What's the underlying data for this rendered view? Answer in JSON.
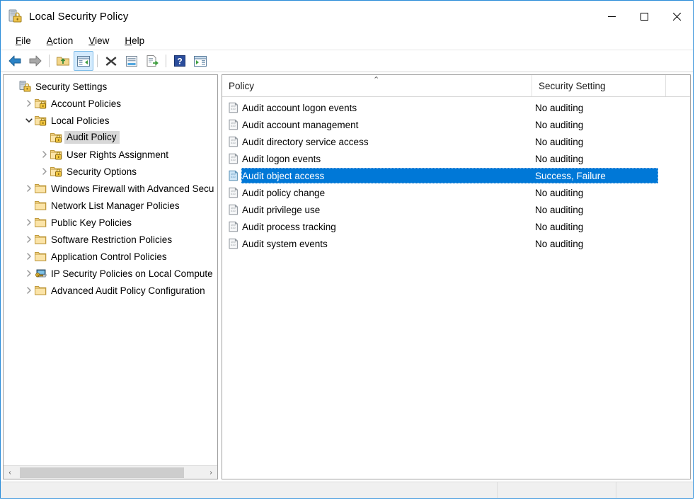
{
  "window": {
    "title": "Local Security Policy",
    "icon": "server-lock-icon",
    "controls": {
      "minimize": "Minimize",
      "maximize": "Maximize",
      "close": "Close"
    }
  },
  "menubar": {
    "items": [
      {
        "label": "File",
        "accel": "F"
      },
      {
        "label": "Action",
        "accel": "A"
      },
      {
        "label": "View",
        "accel": "V"
      },
      {
        "label": "Help",
        "accel": "H"
      }
    ]
  },
  "toolbar": {
    "buttons": [
      {
        "name": "back-button",
        "icon": "arrow-left-icon",
        "title": "Back",
        "pressed": false
      },
      {
        "name": "forward-button",
        "icon": "arrow-right-icon",
        "title": "Forward",
        "pressed": false
      },
      {
        "name": "up-one-level-button",
        "icon": "folder-up-icon",
        "title": "Up One Level",
        "pressed": false
      },
      {
        "name": "show-hide-tree-button",
        "icon": "console-tree-icon",
        "title": "Show/Hide Console Tree",
        "pressed": true
      },
      {
        "name": "delete-button",
        "icon": "delete-x-icon",
        "title": "Delete",
        "pressed": false
      },
      {
        "name": "properties-button",
        "icon": "properties-icon",
        "title": "Properties",
        "pressed": false
      },
      {
        "name": "export-list-button",
        "icon": "export-list-icon",
        "title": "Export List",
        "pressed": false
      },
      {
        "name": "help-button",
        "icon": "help-question-icon",
        "title": "Help",
        "pressed": false
      },
      {
        "name": "show-action-pane-button",
        "icon": "action-pane-icon",
        "title": "Show/Hide Action Pane",
        "pressed": false
      }
    ]
  },
  "tree": {
    "nodes": [
      {
        "label": "Security Settings",
        "indent": 0,
        "twist": "none",
        "icon": "server-lock-icon",
        "selected": false
      },
      {
        "label": "Account Policies",
        "indent": 1,
        "twist": "collapsed",
        "icon": "folder-lock-icon",
        "selected": false
      },
      {
        "label": "Local Policies",
        "indent": 1,
        "twist": "expanded",
        "icon": "folder-lock-icon",
        "selected": false
      },
      {
        "label": "Audit Policy",
        "indent": 2,
        "twist": "none",
        "icon": "folder-lock-icon",
        "selected": true
      },
      {
        "label": "User Rights Assignment",
        "indent": 2,
        "twist": "collapsed",
        "icon": "folder-lock-icon",
        "selected": false
      },
      {
        "label": "Security Options",
        "indent": 2,
        "twist": "collapsed",
        "icon": "folder-lock-icon",
        "selected": false
      },
      {
        "label": "Windows Firewall with Advanced Secu",
        "indent": 1,
        "twist": "collapsed",
        "icon": "folder-icon",
        "selected": false
      },
      {
        "label": "Network List Manager Policies",
        "indent": 1,
        "twist": "none",
        "icon": "folder-icon",
        "selected": false
      },
      {
        "label": "Public Key Policies",
        "indent": 1,
        "twist": "collapsed",
        "icon": "folder-icon",
        "selected": false
      },
      {
        "label": "Software Restriction Policies",
        "indent": 1,
        "twist": "collapsed",
        "icon": "folder-icon",
        "selected": false
      },
      {
        "label": "Application Control Policies",
        "indent": 1,
        "twist": "collapsed",
        "icon": "folder-icon",
        "selected": false
      },
      {
        "label": "IP Security Policies on Local Compute",
        "indent": 1,
        "twist": "collapsed",
        "icon": "ipsec-icon",
        "selected": false
      },
      {
        "label": "Advanced Audit Policy Configuration",
        "indent": 1,
        "twist": "collapsed",
        "icon": "folder-icon",
        "selected": false
      }
    ],
    "hscroll": {
      "left_arrow": "‹",
      "right_arrow": "›"
    }
  },
  "list": {
    "columns": [
      {
        "key": "policy",
        "label": "Policy",
        "sorted": "ascending",
        "sort_glyph": "⌃"
      },
      {
        "key": "setting",
        "label": "Security Setting",
        "sorted": "none",
        "sort_glyph": ""
      }
    ],
    "rows": [
      {
        "policy": "Audit account logon events",
        "setting": "No auditing",
        "icon": "policy-doc-icon",
        "selected": false
      },
      {
        "policy": "Audit account management",
        "setting": "No auditing",
        "icon": "policy-doc-icon",
        "selected": false
      },
      {
        "policy": "Audit directory service access",
        "setting": "No auditing",
        "icon": "policy-doc-icon",
        "selected": false
      },
      {
        "policy": "Audit logon events",
        "setting": "No auditing",
        "icon": "policy-doc-icon",
        "selected": false
      },
      {
        "policy": "Audit object access",
        "setting": "Success, Failure",
        "icon": "policy-doc-icon",
        "selected": true
      },
      {
        "policy": "Audit policy change",
        "setting": "No auditing",
        "icon": "policy-doc-icon",
        "selected": false
      },
      {
        "policy": "Audit privilege use",
        "setting": "No auditing",
        "icon": "policy-doc-icon",
        "selected": false
      },
      {
        "policy": "Audit process tracking",
        "setting": "No auditing",
        "icon": "policy-doc-icon",
        "selected": false
      },
      {
        "policy": "Audit system events",
        "setting": "No auditing",
        "icon": "policy-doc-icon",
        "selected": false
      }
    ]
  },
  "statusbar": {
    "segments": [
      "",
      "",
      ""
    ]
  },
  "colors": {
    "selection_blue": "#0078d7",
    "window_border": "#2a8cd8",
    "tree_selection_gray": "#d8d8d8",
    "status_bg": "#f0f0f0"
  }
}
